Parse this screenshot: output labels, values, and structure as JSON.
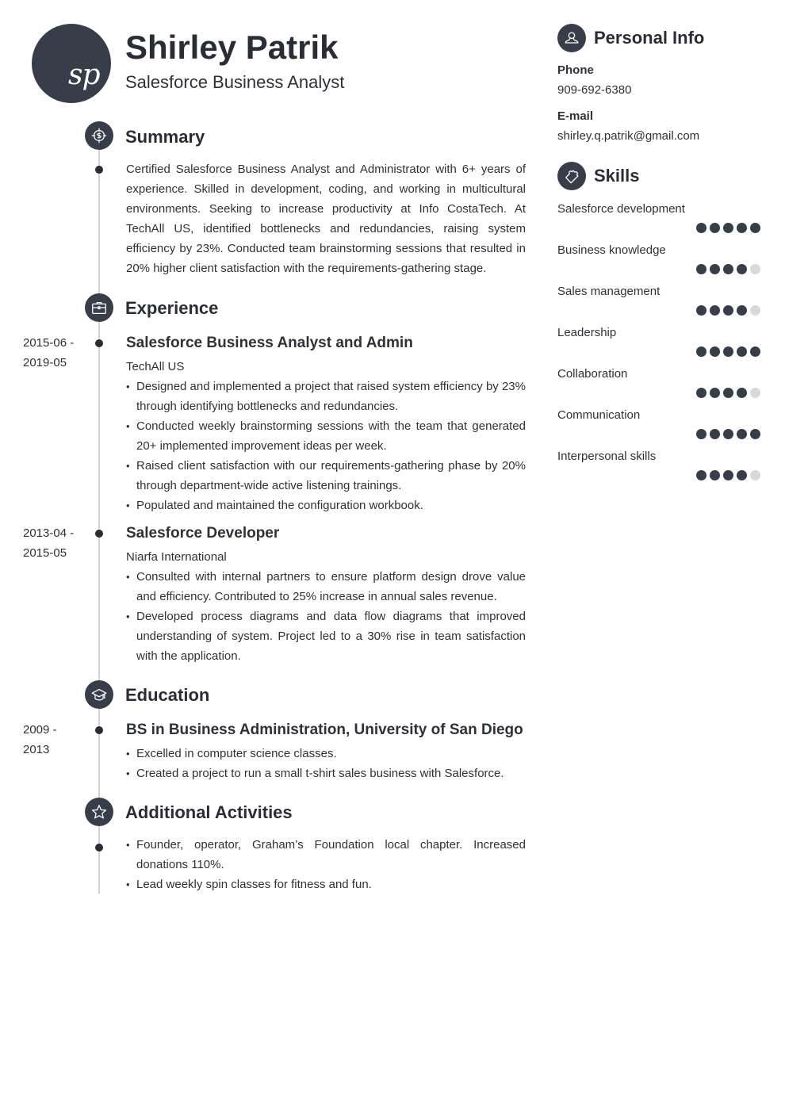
{
  "header": {
    "monogram": "sp",
    "name": "Shirley Patrik",
    "title": "Salesforce Business Analyst"
  },
  "summary": {
    "heading": "Summary",
    "icon": "target-icon",
    "text": "Certified Salesforce Business Analyst and Administrator with 6+ years of experience. Skilled in development, coding, and working in multicultural environments. Seeking to increase productivity at Info CostaTech. At TechAll US, identified bottlenecks and redundancies, raising system efficiency by 23%. Conducted team brainstorming sessions that resulted in 20% higher client satisfaction with the requirements-gathering stage."
  },
  "experience": {
    "heading": "Experience",
    "icon": "briefcase-icon",
    "items": [
      {
        "date_start": "2015-06 -",
        "date_end": "2019-05",
        "title": "Salesforce Business Analyst and Admin",
        "org": "TechAll US",
        "bullets": [
          "Designed and implemented a project that raised system efficiency by 23% through identifying bottlenecks and redundancies.",
          "Conducted weekly brainstorming sessions with the team that generated 20+ implemented improvement ideas per week.",
          "Raised client satisfaction with our requirements-gathering phase by 20% through department-wide active listening trainings.",
          "Populated and maintained the configuration workbook."
        ]
      },
      {
        "date_start": "2013-04 -",
        "date_end": "2015-05",
        "title": "Salesforce Developer",
        "org": "Niarfa International",
        "bullets": [
          "Consulted with internal partners to ensure platform design drove value and efficiency. Contributed to 25% increase in annual sales revenue.",
          "Developed process diagrams and data flow diagrams that improved understanding of system. Project led to a 30% rise in team satisfaction with the application."
        ]
      }
    ]
  },
  "education": {
    "heading": "Education",
    "icon": "graduation-cap-icon",
    "items": [
      {
        "date_start": "2009 -",
        "date_end": "2013",
        "title": "BS in Business Administration, University of San Diego",
        "bullets": [
          "Excelled in computer science classes.",
          "Created a project to run a small t-shirt sales business with Salesforce."
        ]
      }
    ]
  },
  "activities": {
    "heading": "Additional Activities",
    "icon": "star-icon",
    "bullets": [
      "Founder, operator, Graham’s Foundation local chapter. Increased donations 110%.",
      "Lead weekly spin classes for fitness and fun."
    ]
  },
  "personal_info": {
    "heading": "Personal Info",
    "icon": "user-icon",
    "phone_label": "Phone",
    "phone": "909-692-6380",
    "email_label": "E-mail",
    "email": "shirley.q.patrik@gmail.com"
  },
  "skills": {
    "heading": "Skills",
    "icon": "puzzle-icon",
    "max_level": 5,
    "items": [
      {
        "name": "Salesforce development",
        "level": 5
      },
      {
        "name": "Business knowledge",
        "level": 4
      },
      {
        "name": "Sales management",
        "level": 4
      },
      {
        "name": "Leadership",
        "level": 5
      },
      {
        "name": "Collaboration",
        "level": 4
      },
      {
        "name": "Communication",
        "level": 5
      },
      {
        "name": "Interpersonal skills",
        "level": 4
      }
    ]
  },
  "colors": {
    "accent": "#383d4a",
    "timeline": "#d4d4d4",
    "dot_empty": "#d9d9d9"
  }
}
